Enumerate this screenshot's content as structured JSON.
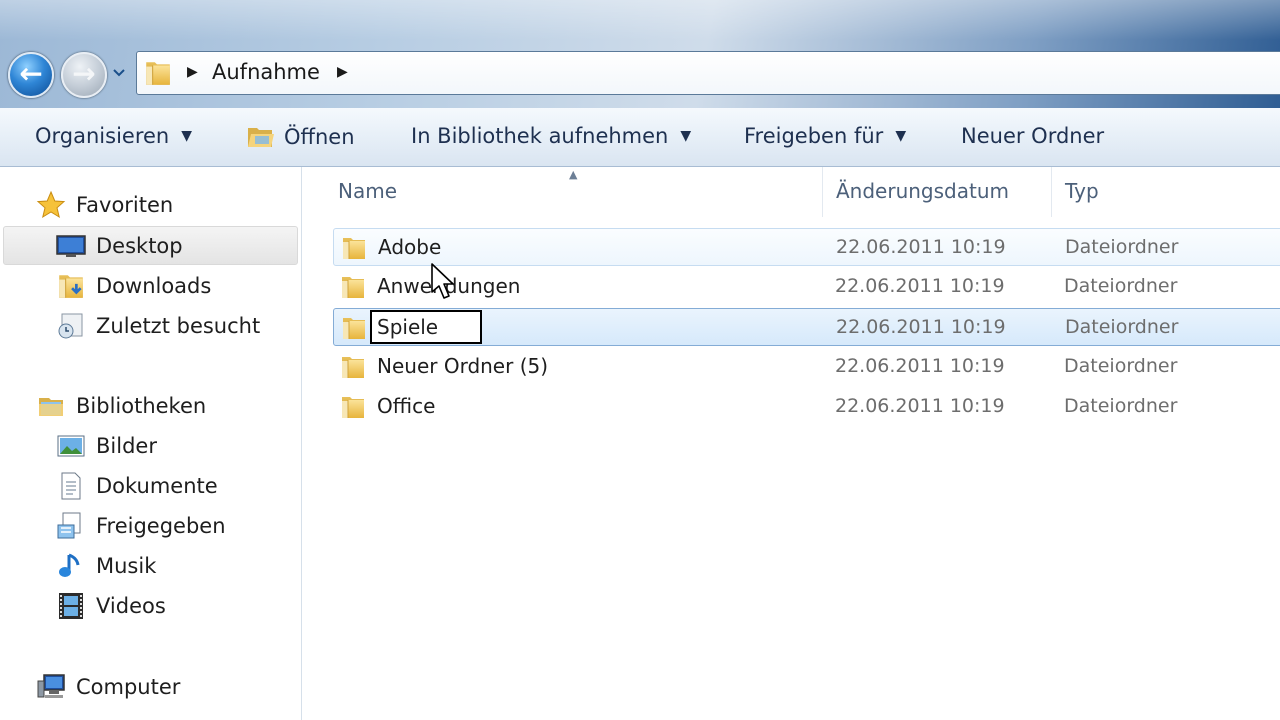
{
  "address": {
    "crumbs": [
      "Aufnahme"
    ]
  },
  "commandbar": {
    "organize": "Organisieren",
    "open": "Öffnen",
    "library": "In Bibliothek aufnehmen",
    "share": "Freigeben für",
    "new_folder": "Neuer Ordner"
  },
  "navpane": {
    "favorites": {
      "label": "Favoriten",
      "items": [
        {
          "label": "Desktop",
          "icon": "desktop-icon",
          "selected": true
        },
        {
          "label": "Downloads",
          "icon": "downloads-folder-icon"
        },
        {
          "label": "Zuletzt besucht",
          "icon": "recent-places-icon"
        }
      ]
    },
    "libraries": {
      "label": "Bibliotheken",
      "items": [
        {
          "label": "Bilder",
          "icon": "pictures-icon"
        },
        {
          "label": "Dokumente",
          "icon": "documents-icon"
        },
        {
          "label": "Freigegeben",
          "icon": "shared-icon"
        },
        {
          "label": "Musik",
          "icon": "music-icon"
        },
        {
          "label": "Videos",
          "icon": "videos-icon"
        }
      ]
    },
    "computer": {
      "label": "Computer",
      "icon": "computer-icon"
    }
  },
  "filelist": {
    "columns": {
      "name": "Name",
      "date": "Änderungsdatum",
      "type": "Typ"
    },
    "rows": [
      {
        "name": "Adobe",
        "date": "22.06.2011 10:19",
        "type": "Dateiordner",
        "state": "hover"
      },
      {
        "name": "Anwendungen",
        "date": "22.06.2011 10:19",
        "type": "Dateiordner",
        "state": "normal"
      },
      {
        "name": "Spiele",
        "date": "22.06.2011 10:19",
        "type": "Dateiordner",
        "state": "renaming"
      },
      {
        "name": "Neuer Ordner (5)",
        "date": "22.06.2011 10:19",
        "type": "Dateiordner",
        "state": "normal"
      },
      {
        "name": "Office",
        "date": "22.06.2011 10:19",
        "type": "Dateiordner",
        "state": "normal"
      }
    ]
  },
  "colors": {
    "accent": "#2f86d6",
    "selection_border": "#84acd6",
    "folder_yellow": "#f3c94b"
  }
}
